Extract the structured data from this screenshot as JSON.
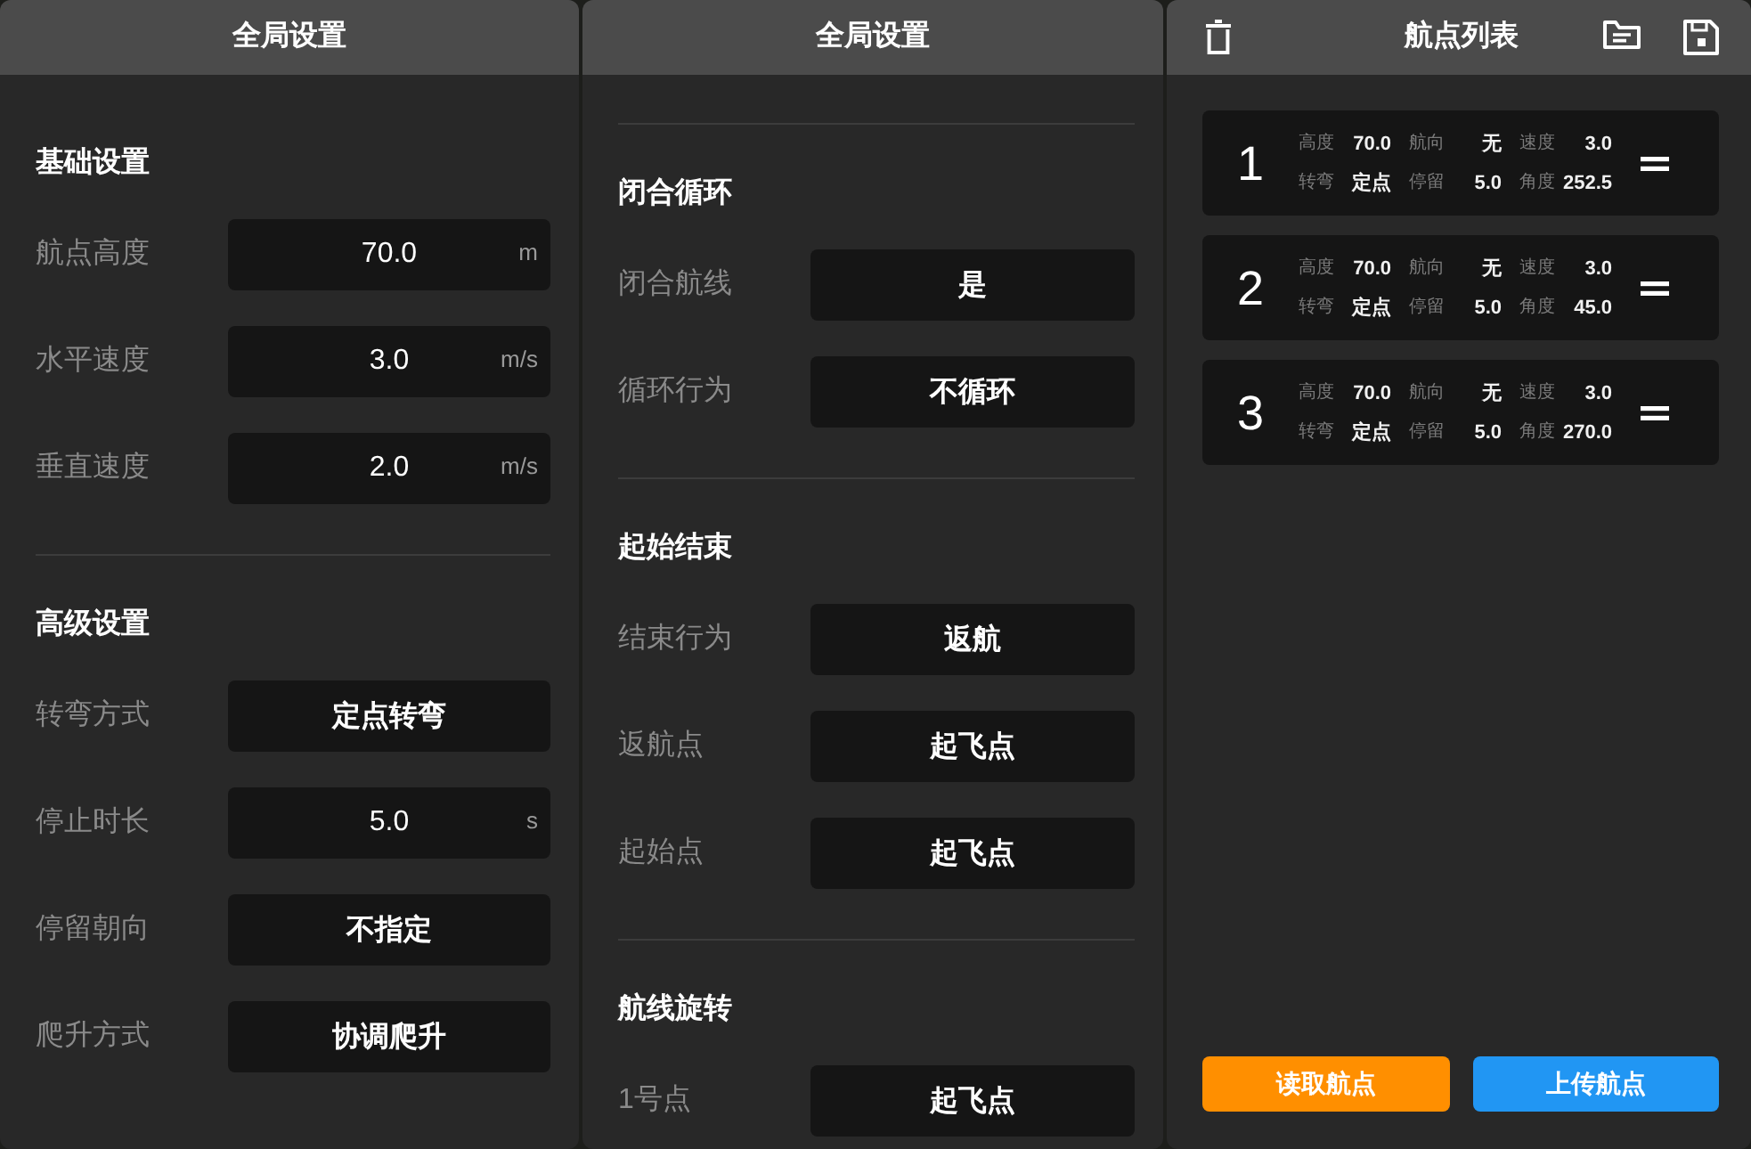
{
  "settings_panels": [
    {
      "title": "全局设置",
      "scrolled": false,
      "sections": [
        {
          "title": "基础设置",
          "rows": [
            {
              "label": "航点高度",
              "kind": "number",
              "value": "70.0",
              "unit": "m"
            },
            {
              "label": "水平速度",
              "kind": "number",
              "value": "3.0",
              "unit": "m/s"
            },
            {
              "label": "垂直速度",
              "kind": "number",
              "value": "2.0",
              "unit": "m/s"
            }
          ]
        },
        {
          "title": "高级设置",
          "rows": [
            {
              "label": "转弯方式",
              "kind": "select",
              "value": "定点转弯"
            },
            {
              "label": "停止时长",
              "kind": "number",
              "value": "5.0",
              "unit": "s"
            },
            {
              "label": "停留朝向",
              "kind": "select",
              "value": "不指定"
            },
            {
              "label": "爬升方式",
              "kind": "select",
              "value": "协调爬升"
            }
          ]
        }
      ]
    },
    {
      "title": "全局设置",
      "scrolled": true,
      "sections": [
        {
          "title": "闭合循环",
          "rows": [
            {
              "label": "闭合航线",
              "kind": "select",
              "value": "是"
            },
            {
              "label": "循环行为",
              "kind": "select",
              "value": "不循环"
            }
          ]
        },
        {
          "title": "起始结束",
          "rows": [
            {
              "label": "结束行为",
              "kind": "select",
              "value": "返航"
            },
            {
              "label": "返航点",
              "kind": "select",
              "value": "起飞点"
            },
            {
              "label": "起始点",
              "kind": "select",
              "value": "起飞点"
            }
          ]
        },
        {
          "title": "航线旋转",
          "rows": [
            {
              "label": "1号点",
              "kind": "select",
              "value": "起飞点"
            }
          ]
        }
      ]
    }
  ],
  "waypoint_panel": {
    "title": "航点列表",
    "waypoints": [
      {
        "number": "1",
        "details": [
          {
            "label": "高度",
            "value": "70.0"
          },
          {
            "label": "航向",
            "value": "无"
          },
          {
            "label": "速度",
            "value": "3.0"
          },
          {
            "label": "转弯",
            "value": "定点"
          },
          {
            "label": "停留",
            "value": "5.0"
          },
          {
            "label": "角度",
            "value": "252.5"
          }
        ]
      },
      {
        "number": "2",
        "details": [
          {
            "label": "高度",
            "value": "70.0"
          },
          {
            "label": "航向",
            "value": "无"
          },
          {
            "label": "速度",
            "value": "3.0"
          },
          {
            "label": "转弯",
            "value": "定点"
          },
          {
            "label": "停留",
            "value": "5.0"
          },
          {
            "label": "角度",
            "value": "45.0"
          }
        ]
      },
      {
        "number": "3",
        "details": [
          {
            "label": "高度",
            "value": "70.0"
          },
          {
            "label": "航向",
            "value": "无"
          },
          {
            "label": "速度",
            "value": "3.0"
          },
          {
            "label": "转弯",
            "value": "定点"
          },
          {
            "label": "停留",
            "value": "5.0"
          },
          {
            "label": "角度",
            "value": "270.0"
          }
        ]
      }
    ],
    "buttons": [
      {
        "label": "读取航点",
        "color": "#ff8f00"
      },
      {
        "label": "上传航点",
        "color": "#2196f3"
      }
    ]
  }
}
